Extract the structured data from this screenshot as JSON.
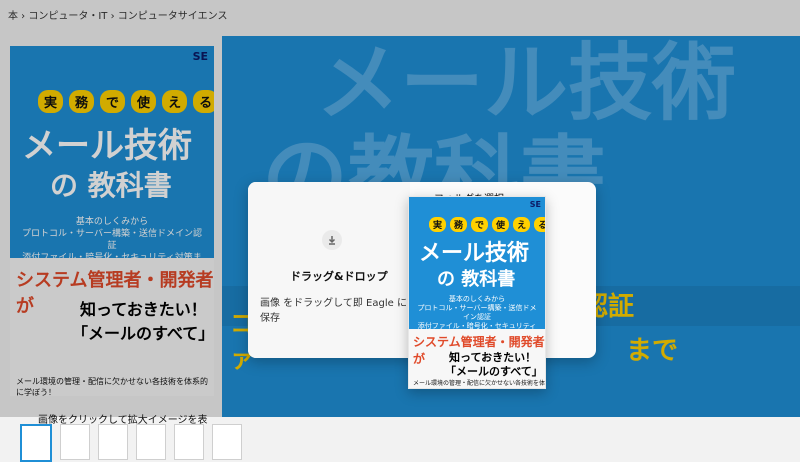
{
  "breadcrumb": "本 › コンピュータ・IT › コンピュータサイエンス",
  "book": {
    "se_logo": "SE",
    "badges": [
      "実",
      "務",
      "で",
      "使",
      "え",
      "る"
    ],
    "title_line1": "メール技術",
    "title_line2": "の 教科書",
    "subtitle_lines": [
      "基本のしくみから",
      "プロトコル・サーバー構築・送信ドメイン認証",
      "添付ファイル・暗号化・セキュリティ対策まで"
    ],
    "tagline1": "システム管理者・開発者が",
    "tagline2": "知っておきたい！",
    "tagline3": "「メールのすべて」",
    "footer": "メール環境の管理・配信に欠かせない各技術を体系的に学ぼう！"
  },
  "gallery": {
    "instruction": "画像をクリックして拡大イメージを表示",
    "thumb_count": 6,
    "active_index": 0
  },
  "hero_overlay_text": {
    "top": "メール技術",
    "middle": "の教科書",
    "left_partial": "コ",
    "left_partial2": "ァ",
    "right_partial": "認証",
    "right_partial2": "まで"
  },
  "modal": {
    "drag_title": "ドラッグ&ドロップ",
    "drag_sub": "画像 をドラッグして即 Eagle に保存",
    "folder_label": "フォルダを選択"
  }
}
